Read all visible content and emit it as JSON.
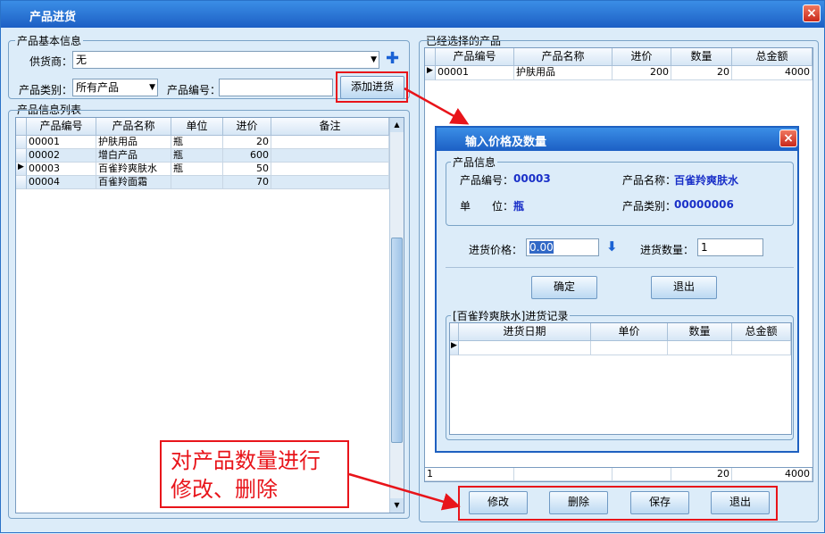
{
  "window": {
    "title": "产品进货",
    "close_icon": "×"
  },
  "basic_info": {
    "legend": "产品基本信息",
    "supplier_label": "供货商：",
    "supplier_value": "无",
    "category_label": "产品类别：",
    "category_value": "所有产品",
    "code_label": "产品编号：",
    "code_value": "",
    "add_button": "添加进货"
  },
  "product_list": {
    "legend": "产品信息列表",
    "headers": [
      "产品编号",
      "产品名称",
      "单位",
      "进价",
      "备注"
    ],
    "rows": [
      [
        "00001",
        "护肤用品",
        "瓶",
        "20",
        ""
      ],
      [
        "00002",
        "增白产品",
        "瓶",
        "600",
        ""
      ],
      [
        "00003",
        "百雀羚爽肤水",
        "瓶",
        "50",
        ""
      ],
      [
        "00004",
        "百雀羚面霜",
        "",
        "70",
        ""
      ]
    ],
    "selected_row": 2
  },
  "selected": {
    "legend": "已经选择的产品",
    "headers": [
      "产品编号",
      "产品名称",
      "进价",
      "数量",
      "总金额"
    ],
    "rows": [
      [
        "00001",
        "护肤用品",
        "200",
        "20",
        "4000"
      ]
    ],
    "footer": [
      "1",
      "",
      "",
      "20",
      "4000"
    ]
  },
  "dialog": {
    "title": "输入价格及数量",
    "info_legend": "产品信息",
    "code_label": "产品编号：",
    "code_value": "00003",
    "name_label": "产品名称：",
    "name_value": "百雀羚爽肤水",
    "unit_label": "单　　位：",
    "unit_value": "瓶",
    "category_label": "产品类别：",
    "category_value": "00000006",
    "price_label": "进货价格：",
    "price_value": "0.00",
    "qty_label": "进货数量：",
    "qty_value": "1",
    "ok_button": "确定",
    "exit_button": "退出",
    "history_legend": "[百雀羚爽肤水]进货记录",
    "history_headers": [
      "进货日期",
      "单价",
      "数量",
      "总金额"
    ]
  },
  "actions": {
    "modify": "修改",
    "delete": "删除",
    "save": "保存",
    "exit": "退出"
  },
  "annotation": {
    "line1": "对产品数量进行",
    "line2": "修改、删除"
  }
}
